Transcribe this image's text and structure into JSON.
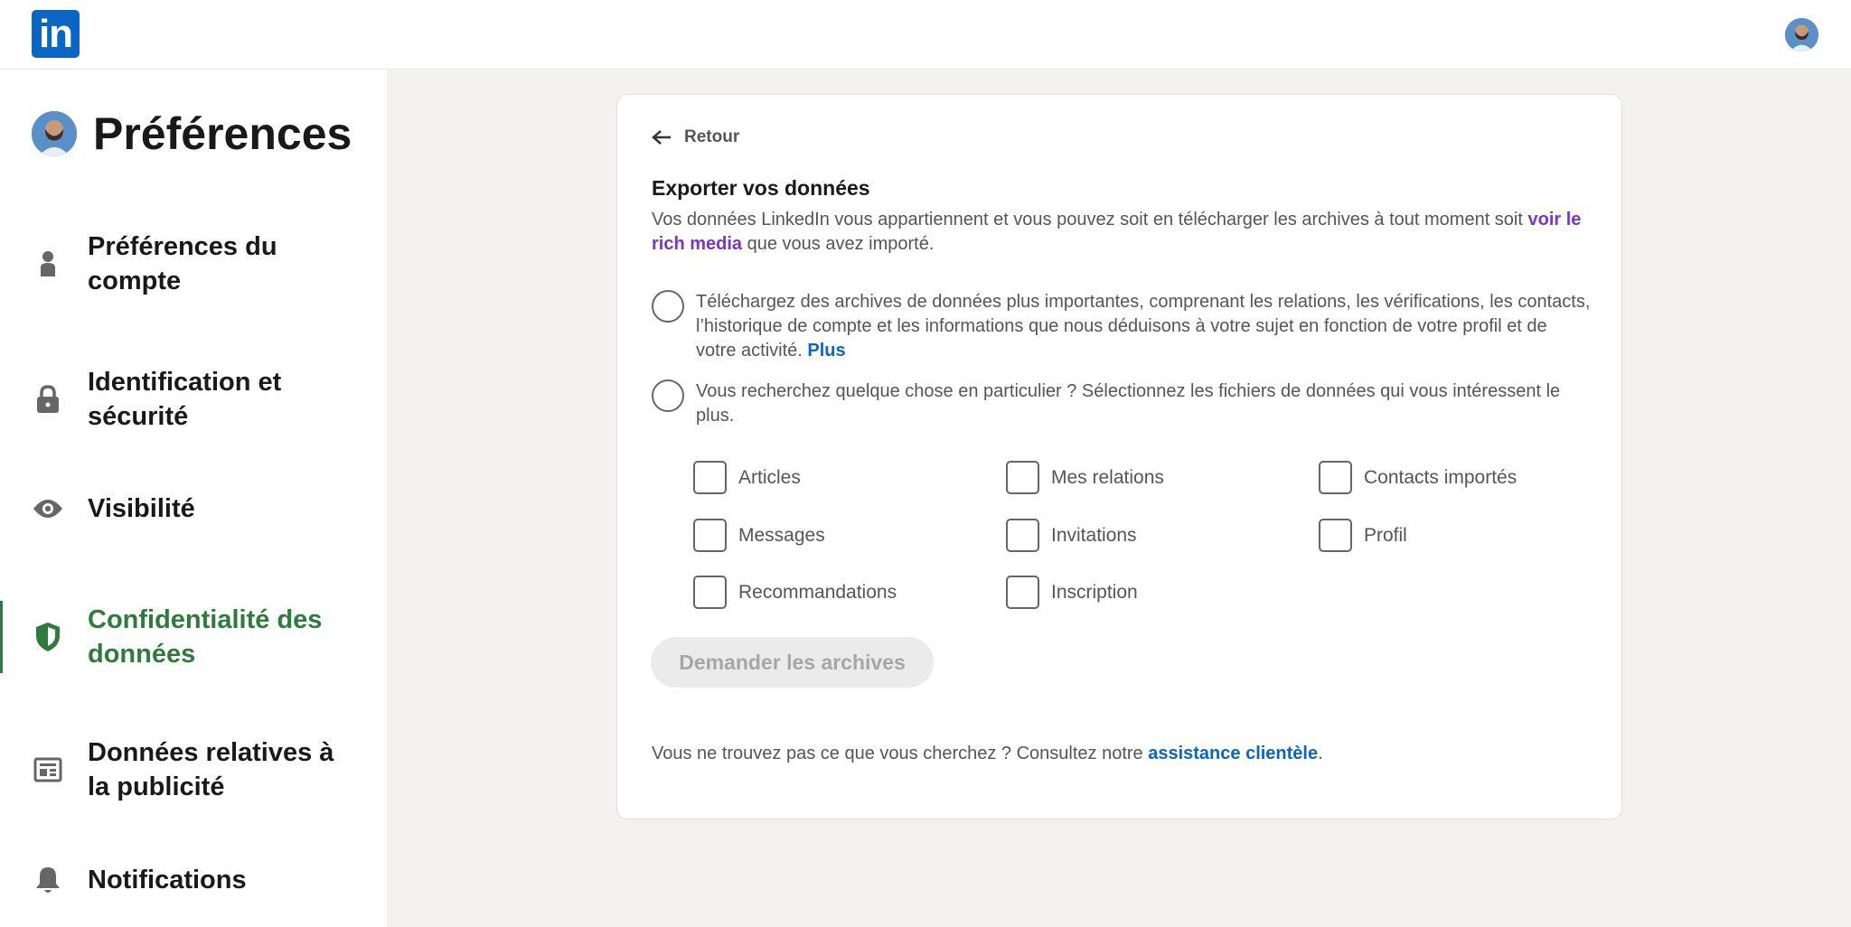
{
  "header": {
    "logo_text": "in",
    "brand_color": "#0a66c2"
  },
  "sidebar": {
    "title": "Préférences",
    "active_color": "#2f7a3d",
    "items": [
      {
        "label": "Préférences du compte",
        "icon": "person-icon"
      },
      {
        "label": "Identification et sécurité",
        "icon": "lock-icon"
      },
      {
        "label": "Visibilité",
        "icon": "eye-icon"
      },
      {
        "label": "Confidentialité des données",
        "icon": "shield-icon",
        "active": true
      },
      {
        "label": "Données relatives à la publicité",
        "icon": "ad-icon"
      },
      {
        "label": "Notifications",
        "icon": "bell-icon"
      }
    ]
  },
  "main": {
    "back_label": "Retour",
    "title": "Exporter vos données",
    "desc_part1": "Vos données LinkedIn vous appartiennent et vous pouvez soit en télécharger les archives à tout moment soit ",
    "desc_link": "voir le rich media",
    "desc_part2": " que vous avez importé.",
    "option1_text": "Téléchargez des archives de données plus importantes, comprenant les relations, les vérifications, les contacts, l’historique de compte et les informations que nous déduisons à votre sujet en fonction de votre profil et de votre activité. ",
    "option1_link": "Plus",
    "option2_text": "Vous recherchez quelque chose en particulier ? Sélectionnez les fichiers de données qui vous intéressent le plus.",
    "checkboxes": [
      "Articles",
      "Mes relations",
      "Contacts importés",
      "Messages",
      "Invitations",
      "Profil",
      "Recommandations",
      "Inscription"
    ],
    "submit_label": "Demander les archives",
    "footer_text": "Vous ne trouvez pas ce que vous cherchez ? Consultez notre ",
    "footer_link": "assistance clientèle",
    "footer_end": "."
  }
}
